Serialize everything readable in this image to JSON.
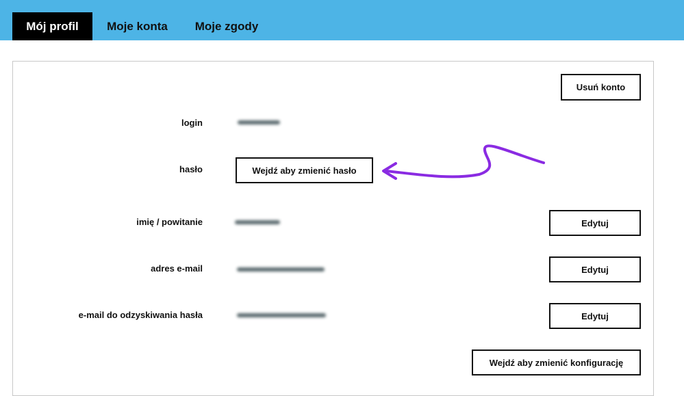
{
  "tabs": [
    {
      "label": "Mój profil",
      "active": true
    },
    {
      "label": "Moje konta",
      "active": false
    },
    {
      "label": "Moje zgody",
      "active": false
    }
  ],
  "actions": {
    "delete_account": "Usuń konto",
    "change_password": "Wejdź aby zmienić hasło",
    "change_config": "Wejdź aby zmienić konfigurację"
  },
  "fields": [
    {
      "label": "login",
      "value_hidden": true
    },
    {
      "label": "hasło"
    },
    {
      "label": "imię / powitanie",
      "value_hidden": true,
      "action": "Edytuj"
    },
    {
      "label": "adres e-mail",
      "value_hidden": true,
      "action": "Edytuj"
    },
    {
      "label": "e-mail do odzyskiwania hasła",
      "value_hidden": true,
      "action": "Edytuj"
    }
  ],
  "colors": {
    "topbar": "#4db4e6",
    "active_tab": "#000000",
    "annotation_arrow": "#8a2be2"
  }
}
